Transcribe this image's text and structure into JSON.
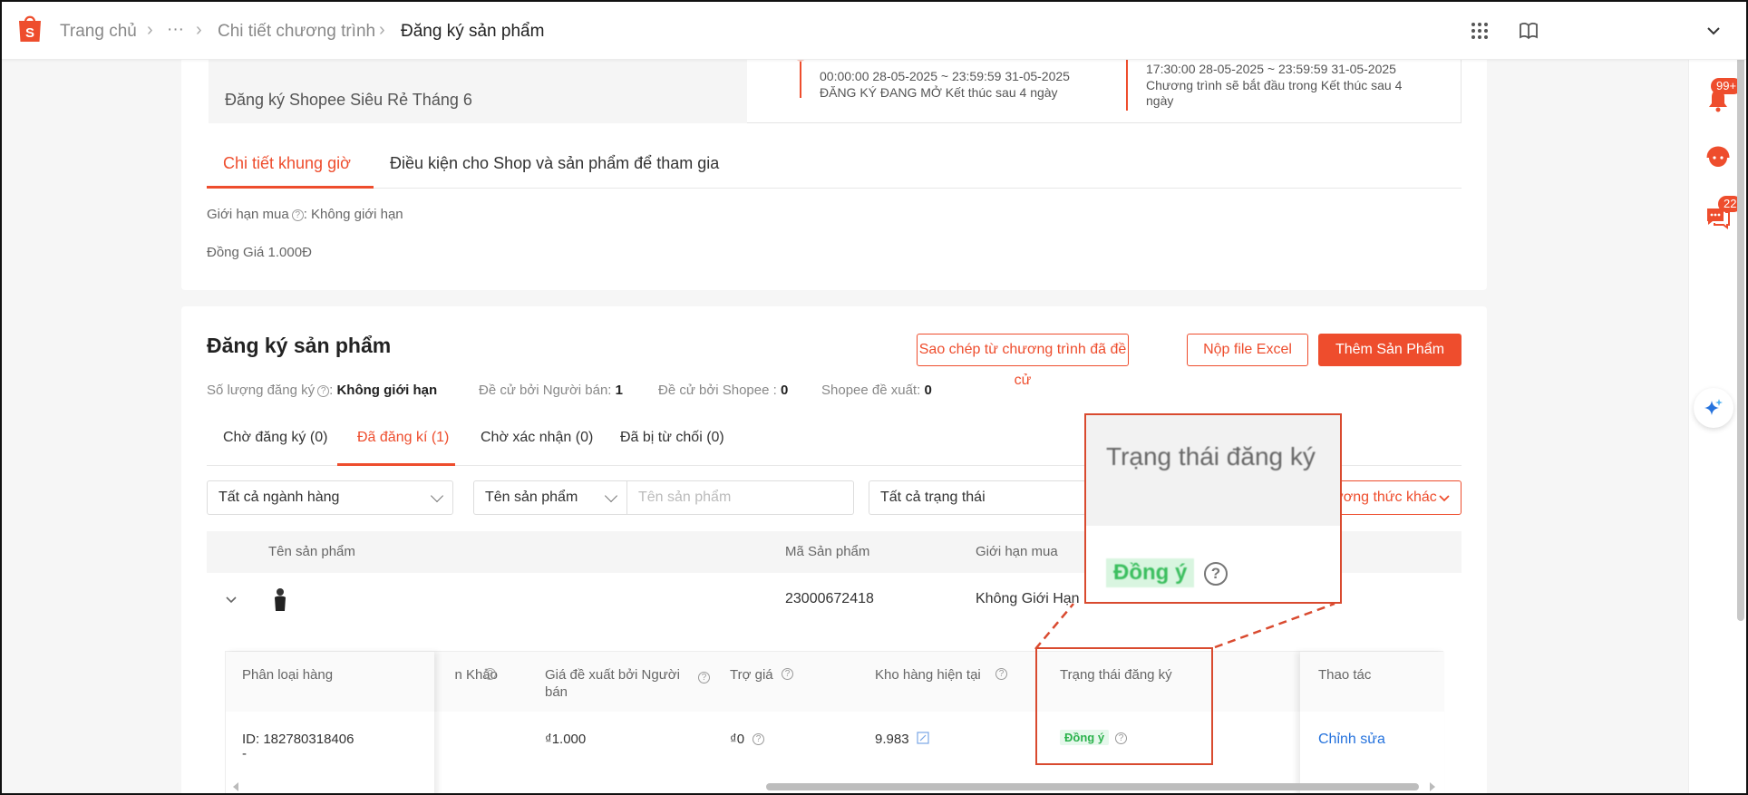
{
  "breadcrumb": {
    "home": "Trang chủ",
    "ellipsis": "···",
    "detail": "Chi tiết chương trình",
    "current": "Đăng ký sản phẩm"
  },
  "rail": {
    "notif_badge": "99+",
    "chat_badge": "22"
  },
  "program": {
    "name": "Đăng ký Shopee Siêu Rẻ Tháng 6",
    "timeline": [
      {
        "range": "00:00:00 28-05-2025 ~ 23:59:59 31-05-2025",
        "status": "ĐĂNG KÝ ĐANG MỞ Kết thúc sau 4 ngày"
      },
      {
        "range": "17:30:00 28-05-2025 ~ 23:59:59 31-05-2025",
        "status": "Chương trình sẽ bắt đầu trong Kết thúc sau 4 ngày"
      }
    ]
  },
  "detail_tabs": [
    "Chi tiết khung giờ",
    "Điều kiện cho Shop và sản phẩm để tham gia"
  ],
  "detail_info": {
    "purchase_limit": "Giới hạn mua",
    "purchase_limit_value": ": Không giới hạn",
    "same_price": "Đồng Giá 1.000Đ"
  },
  "register": {
    "title": "Đăng ký sản phẩm",
    "buttons": {
      "copy": "Sao chép từ chương trình đã đề cử",
      "excel": "Nộp file Excel",
      "add": "Thêm Sản Phẩm"
    },
    "stats": [
      {
        "label": "Số lượng đăng ký",
        "value": "Không giới hạn",
        "help": true
      },
      {
        "label": "Đề cử bởi Người bán: ",
        "value": "1"
      },
      {
        "label": "Đề cử bởi Shopee : ",
        "value": "0"
      },
      {
        "label": "Shopee đề xuất: ",
        "value": "0"
      }
    ],
    "tabs": [
      "Chờ đăng ký (0)",
      "Đã đăng kí (1)",
      "Chờ xác nhận (0)",
      "Đã bị từ chối (0)"
    ],
    "filters": {
      "category": "Tất cả ngành hàng",
      "search_field": "Tên sản phẩm",
      "search_placeholder": "Tên sản phẩm",
      "status": "Tất cả trạng thái",
      "other": "ương thức khác"
    },
    "table": {
      "columns": [
        "Tên sản phẩm",
        "Mã Sản phẩm",
        "Giới hạn mua"
      ],
      "product": {
        "id": "23000672418",
        "limit": "Không Giới Hạn"
      }
    },
    "subtable": {
      "columns": [
        "Phân loại hàng",
        "n Khảo",
        "Giá đề xuất bởi Người bán",
        "Trợ giá",
        "Kho hàng hiện tại",
        "Trạng thái đăng ký",
        "Thao tác"
      ],
      "row": {
        "variant_id": "ID: 182780318406",
        "variant_sub": "-",
        "price": "₫1.000",
        "subsidy": "₫0",
        "stock": "9.983",
        "status": "Đồng ý",
        "action": "Chỉnh sửa"
      }
    }
  },
  "callout": {
    "title": "Trạng thái đăng ký",
    "badge": "Đồng ý"
  },
  "colors": {
    "brand": "#ee4d2d",
    "success": "#2bb24c",
    "link": "#2673dd",
    "callout": "#d94a2f"
  }
}
